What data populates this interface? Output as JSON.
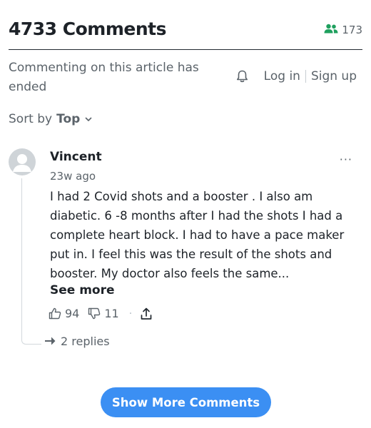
{
  "header": {
    "title": "4733 Comments",
    "viewer_count": "173",
    "viewer_icon": "people-icon"
  },
  "notice": {
    "text": "Commenting on this article has ended"
  },
  "auth": {
    "bell_icon": "bell-icon",
    "login_label": "Log in",
    "signup_label": "Sign up"
  },
  "sort": {
    "label": "Sort by",
    "value": "Top"
  },
  "comment": {
    "author": "Vincent",
    "time": "23w ago",
    "body": "I had 2 Covid  shots and a booster . I also am diabetic. 6 -8 months after I had the shots  I had a complete heart block. I had to have a pace maker put in. I feel this was the result of the shots and booster. My doctor also feels the same...",
    "see_more": "See more",
    "more_menu": "···",
    "likes": "94",
    "dislikes": "11",
    "separator": "·",
    "replies": "2 replies"
  },
  "footer": {
    "show_more_label": "Show More Comments"
  },
  "colors": {
    "accent": "#3b8ff3",
    "viewer_icon": "#1fa05e",
    "text_primary": "#1d2228",
    "text_secondary": "#5b636a"
  }
}
